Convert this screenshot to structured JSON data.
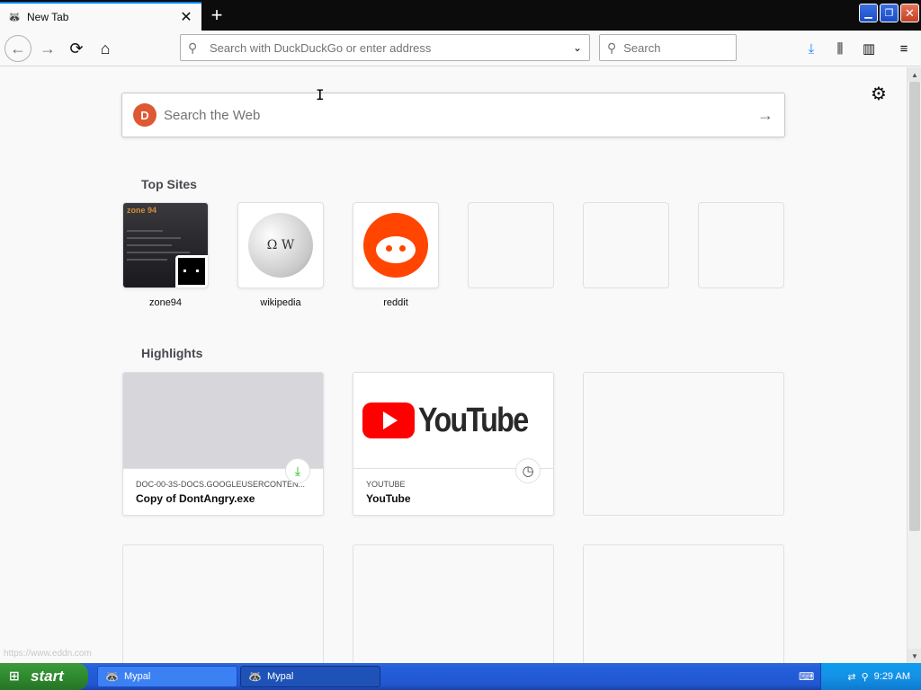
{
  "browser": {
    "tab": {
      "title": "New Tab",
      "favicon": "mypal-icon",
      "close": "✕"
    },
    "new_tab": "+",
    "window_controls": {
      "minimize": "▁",
      "restore": "❐",
      "close": "✕"
    },
    "nav": {
      "back": "←",
      "forward": "→",
      "reload": "⟳",
      "home": "⌂"
    },
    "url_placeholder": "Search with DuckDuckGo or enter address",
    "search_placeholder": "Search",
    "toolbar": {
      "download": "⤓",
      "library": "⫼",
      "sidebar": "▥",
      "menu": "≡"
    }
  },
  "newtab": {
    "websearch_placeholder": "Search the Web",
    "top_sites_title": "Top Sites",
    "top_sites": [
      {
        "label": "zone94",
        "thumb_header": "zone 94"
      },
      {
        "label": "wikipedia"
      },
      {
        "label": "reddit"
      }
    ],
    "highlights_title": "Highlights",
    "highlights": [
      {
        "source": "DOC-00-3S-DOCS.GOOGLEUSERCONTEN...",
        "title": "Copy of DontAngry.exe",
        "badge": "download-icon"
      },
      {
        "source": "YOUTUBE",
        "title": "YouTube",
        "logo_text": "YouTube",
        "badge": "clock-icon"
      }
    ],
    "status_url": "https://www.eddn.com"
  },
  "taskbar": {
    "start_label": "start",
    "tasks": [
      {
        "label": "Mypal"
      },
      {
        "label": "Mypal"
      }
    ],
    "clock": "9:29 AM"
  }
}
